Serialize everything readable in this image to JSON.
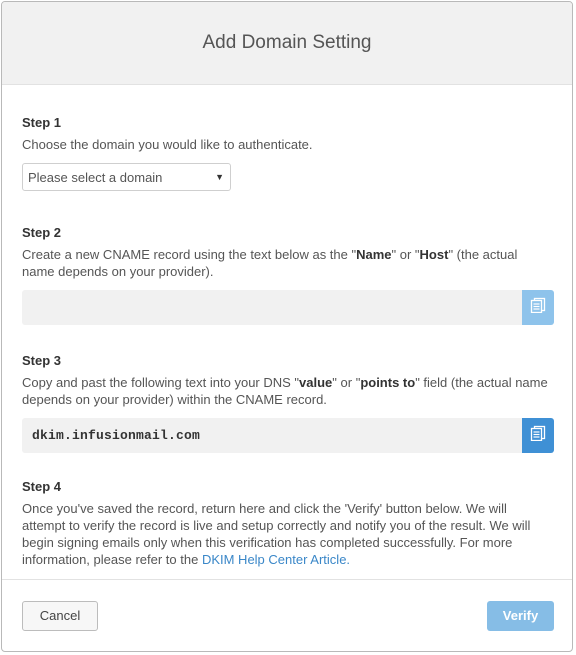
{
  "modal": {
    "title": "Add Domain Setting"
  },
  "step1": {
    "title": "Step 1",
    "desc": "Choose the domain you would like to authenticate.",
    "select_value": "Please select a domain"
  },
  "step2": {
    "title": "Step 2",
    "desc_1": "Create a new CNAME record using the text below as the \"",
    "desc_name": "Name",
    "desc_2": "\" or \"",
    "desc_host": "Host",
    "desc_3": "\" (the actual name depends on your provider).",
    "field_value": ""
  },
  "step3": {
    "title": "Step 3",
    "desc_1": "Copy and past the following text into your DNS \"",
    "desc_value": "value",
    "desc_2": "\" or \"",
    "desc_points": "points to",
    "desc_3": "\" field (the actual name depends on your provider) within the CNAME record.",
    "field_value": "dkim.infusionmail.com"
  },
  "step4": {
    "title": "Step 4",
    "desc": "Once you've saved the record, return here and click the 'Verify' button below. We will attempt to verify the record is live and setup correctly and notify you of the result. We will begin signing emails only when this verification has completed successfully. For more information, please refer to the ",
    "link_text": "DKIM Help Center Article."
  },
  "footer": {
    "cancel_label": "Cancel",
    "verify_label": "Verify"
  },
  "icons": {
    "copy": "copy-icon",
    "dropdown": "chevron-down-icon"
  },
  "colors": {
    "link": "#3a87c8",
    "copy_button_disabled": "#8ec3eb",
    "copy_button_active": "#3f90d5",
    "verify_button": "#86bde6"
  }
}
